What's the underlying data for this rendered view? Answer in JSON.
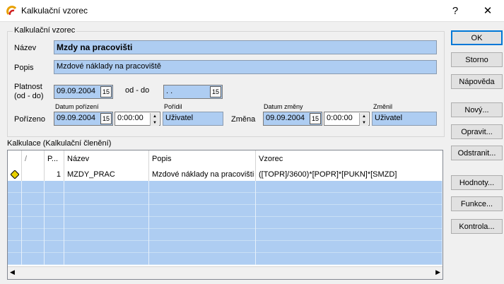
{
  "window": {
    "title": "Kalkulační vzorec",
    "help_label": "?",
    "close_label": "✕"
  },
  "form": {
    "group_title": "Kalkulační vzorec",
    "nazev_label": "Název",
    "nazev_value": "Mzdy na pracovišti",
    "popis_label": "Popis",
    "popis_value": "Mzdové náklady na pracoviště",
    "platnost_label_1": "Platnost",
    "platnost_label_2": "(od - do)",
    "platnost_od": "09.09.2004",
    "od_do_label": "od - do",
    "platnost_do": " .  .",
    "date_btn_label": "15",
    "porizeno_label": "Pořízeno",
    "datum_porizeni_label": "Datum pořízení",
    "datum_porizeni": "09.09.2004",
    "cas_porizeni": "0:00:00",
    "poridil_label": "Pořídil",
    "poridil_value": "Uživatel",
    "zmena_label": "Změna",
    "datum_zmeny_label": "Datum změny",
    "datum_zmeny": "09.09.2004",
    "cas_zmeny": "0:00:00",
    "zmenil_label": "Změnil",
    "zmenil_value": "Uživatel"
  },
  "grid": {
    "title": "Kalkulace (Kalkulační členění)",
    "columns": [
      "/",
      "P...",
      "Název",
      "Popis",
      "Vzorec"
    ],
    "rows": [
      {
        "p": "1",
        "nazev": "MZDY_PRAC",
        "popis": "Mzdové náklady na pracovišti",
        "vzorec": "([TOPR]/3600)*[POPR]*[PUKN]*[SMZD]"
      }
    ]
  },
  "buttons": {
    "ok": "OK",
    "storno": "Storno",
    "napoveda": "Nápověda",
    "novy": "Nový...",
    "opravit": "Opravit...",
    "odstranit": "Odstranit...",
    "hodnoty": "Hodnoty...",
    "funkce": "Funkce...",
    "kontrola": "Kontrola..."
  },
  "colors": {
    "field_bg": "#aecdf2",
    "accent": "#0078d7",
    "marker": "#e8d000"
  }
}
